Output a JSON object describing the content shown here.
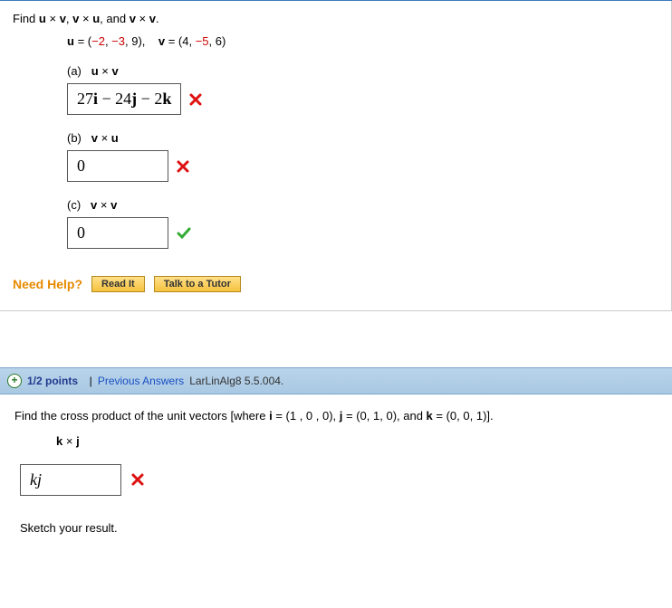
{
  "q1": {
    "prompt_prefix": "Find ",
    "prompt_terms": "u × v, v × u, and v × v.",
    "vectors_line": "u = (−2, −3, 9),    v = (4, −5, 6)",
    "parts": {
      "a": {
        "label": "(a)",
        "expr": "u × v",
        "answer": "27i − 24j − 2k",
        "status": "wrong"
      },
      "b": {
        "label": "(b)",
        "expr": "v × u",
        "answer": "0",
        "status": "wrong"
      },
      "c": {
        "label": "(c)",
        "expr": "v × v",
        "answer": "0",
        "status": "correct"
      }
    },
    "help": {
      "label": "Need Help?",
      "read": "Read It",
      "tutor": "Talk to a Tutor"
    }
  },
  "q2": {
    "header": {
      "points": "1/2 points",
      "sep": "|",
      "prev": "Previous Answers",
      "source": "LarLinAlg8 5.5.004."
    },
    "prompt": "Find the cross product of the unit vectors [where i = (1 , 0 , 0), j = (0, 1, 0), and k = (0, 0, 1)].",
    "expr": "k × j",
    "answer": "kj",
    "status": "wrong",
    "sketch": "Sketch your result."
  }
}
